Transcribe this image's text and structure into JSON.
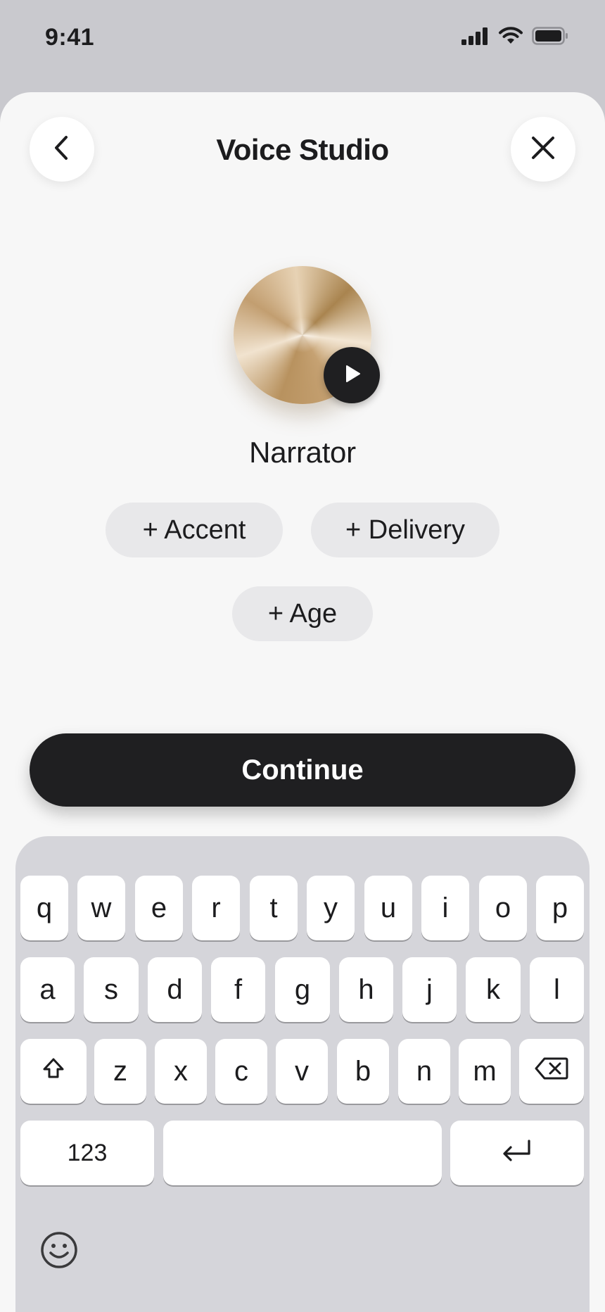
{
  "status_bar": {
    "time": "9:41",
    "icons": [
      "cellular-signal-icon",
      "wifi-icon",
      "battery-icon"
    ]
  },
  "header": {
    "title": "Voice Studio",
    "back_icon": "chevron-left-icon",
    "close_icon": "close-icon"
  },
  "voice": {
    "name": "Narrator",
    "play_icon": "play-icon"
  },
  "chips": {
    "accent": "+ Accent",
    "delivery": "+ Delivery",
    "age": "+ Age"
  },
  "continue_label": "Continue",
  "keyboard": {
    "row1": [
      "q",
      "w",
      "e",
      "r",
      "t",
      "y",
      "u",
      "i",
      "o",
      "p"
    ],
    "row2": [
      "a",
      "s",
      "d",
      "f",
      "g",
      "h",
      "j",
      "k",
      "l"
    ],
    "row3": [
      "z",
      "x",
      "c",
      "v",
      "b",
      "n",
      "m"
    ],
    "numbers_label": "123",
    "shift_icon": "shift-icon",
    "delete_icon": "backspace-icon",
    "return_icon": "return-icon",
    "emoji_icon": "emoji-icon"
  },
  "colors": {
    "background": "#c9c9ce",
    "sheet": "#f7f7f7",
    "primary_button": "#1f1f21",
    "chip": "#e8e8ea",
    "keyboard": "#d5d5da"
  }
}
